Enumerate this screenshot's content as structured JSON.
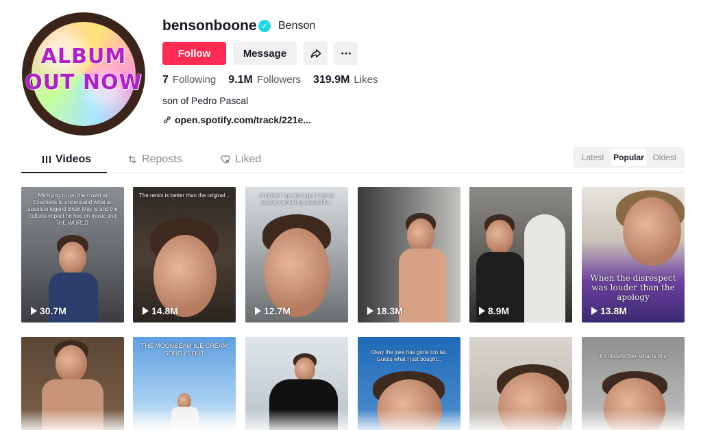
{
  "profile": {
    "avatar_text_1": "ALBUM",
    "avatar_text_2": "OUT NOW",
    "username": "bensonboone",
    "nickname": "Benson",
    "verified_icon": "✓",
    "follow_label": "Follow",
    "message_label": "Message",
    "stats": {
      "following_count": "7",
      "following_label": "Following",
      "followers_count": "9.1M",
      "followers_label": "Followers",
      "likes_count": "319.9M",
      "likes_label": "Likes"
    },
    "bio": "son of Pedro Pascal",
    "link": "open.spotify.com/track/221e..."
  },
  "tabs": [
    {
      "label": "Videos",
      "icon": "grid-icon"
    },
    {
      "label": "Reposts",
      "icon": "repost-icon"
    },
    {
      "label": "Liked",
      "icon": "heart-lock-icon"
    }
  ],
  "sort": [
    "Latest",
    "Popular",
    "Oldest"
  ],
  "videos": [
    {
      "caption": "Me trying to get the crowd at Coachella to understand what an absolute legend Brian May is and the cultural impact he has on music and THE WORLD.",
      "views": "30.7M"
    },
    {
      "caption": "The remix is better than the original...",
      "views": "14.8M"
    },
    {
      "caption": "And then I go and spoil it all by saying something stupid like..",
      "views": "12.7M"
    },
    {
      "caption": "",
      "views": "18.3M"
    },
    {
      "caption": "",
      "views": "8.9M"
    },
    {
      "caption": "When the disrespect was louder than the apology",
      "views": "13.8M"
    },
    {
      "caption": "",
      "views": ""
    },
    {
      "caption": "THE MOONBEAM ICE CREAM SONG IS OUT",
      "views": ""
    },
    {
      "caption": "",
      "views": ""
    },
    {
      "caption": "Okay the joke has gone too far. Guess what I just bought...",
      "views": ""
    },
    {
      "caption": "",
      "views": ""
    },
    {
      "caption": "It's literally 7am what is this",
      "views": ""
    }
  ],
  "colors": {
    "accent": "#fe2c55",
    "verified": "#20d5ec"
  }
}
